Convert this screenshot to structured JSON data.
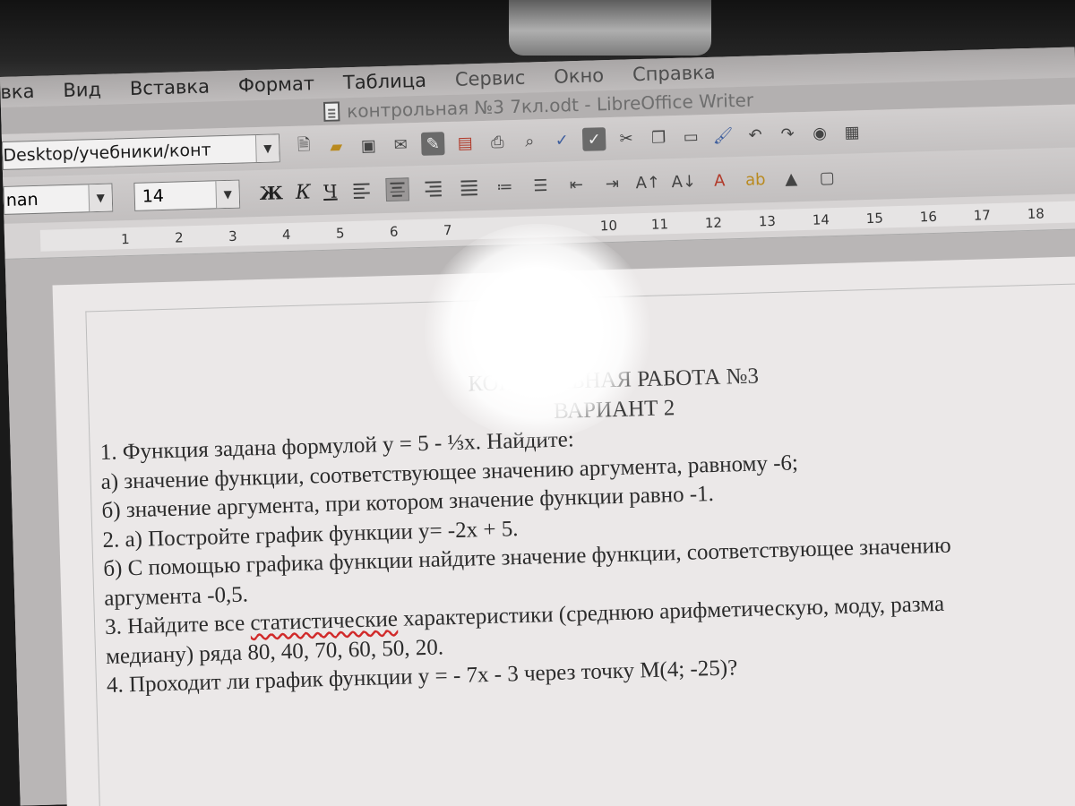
{
  "menu": {
    "items": [
      "вка",
      "Вид",
      "Вставка",
      "Формат",
      "Таблица",
      "Сервис",
      "Окно",
      "Справка"
    ]
  },
  "window": {
    "title": "контрольная №3  7кл.odt - LibreOffice Writer"
  },
  "toolbar": {
    "url_value": "Desktop/учебники/конт",
    "icons": [
      "new-document-icon",
      "open-folder-icon",
      "save-icon",
      "email-icon",
      "edit-mode-icon",
      "export-pdf-icon",
      "print-icon",
      "print-preview-icon",
      "spellcheck-icon",
      "autospellcheck-icon",
      "cut-icon",
      "copy-icon",
      "paste-icon",
      "clone-formatting-icon",
      "undo-icon",
      "redo-icon",
      "navigator-icon",
      "table-icon"
    ]
  },
  "formatting": {
    "font_name": "nan",
    "font_size": "14",
    "bold": "Ж",
    "italic": "К",
    "underline": "Ч"
  },
  "ruler": {
    "ticks": [
      "1",
      "2",
      "3",
      "4",
      "5",
      "6",
      "7",
      "10",
      "11",
      "12",
      "13",
      "14",
      "15",
      "16",
      "17",
      "18"
    ]
  },
  "document": {
    "title_line1": "КОНТРОЛЬНАЯ РАБОТА №3",
    "title_line2": "ВАРИАНТ 2",
    "lines": [
      "1. Функция задана формулой у = 5 - ⅓х. Найдите:",
      "а) значение функции, соответствующее значению аргумента, равному -6;",
      "б) значение аргумента, при котором значение функции равно -1.",
      "2. а) Постройте график функции у= -2х + 5.",
      "б) С помощью графика функции найдите значение функции, соответствующее значению",
      "аргумента -0,5.",
      "3. Найдите все статистические характеристики (среднюю арифметическую, моду, разма",
      "медиану) ряда   80, 40, 70, 60, 50, 20.",
      "4.        Проходит ли график функции у = - 7х - 3 через точку М(4; -25)?"
    ]
  },
  "colors": {
    "spellcheck_underline": "#d12a2a",
    "document_text": "#2b2b2b"
  }
}
